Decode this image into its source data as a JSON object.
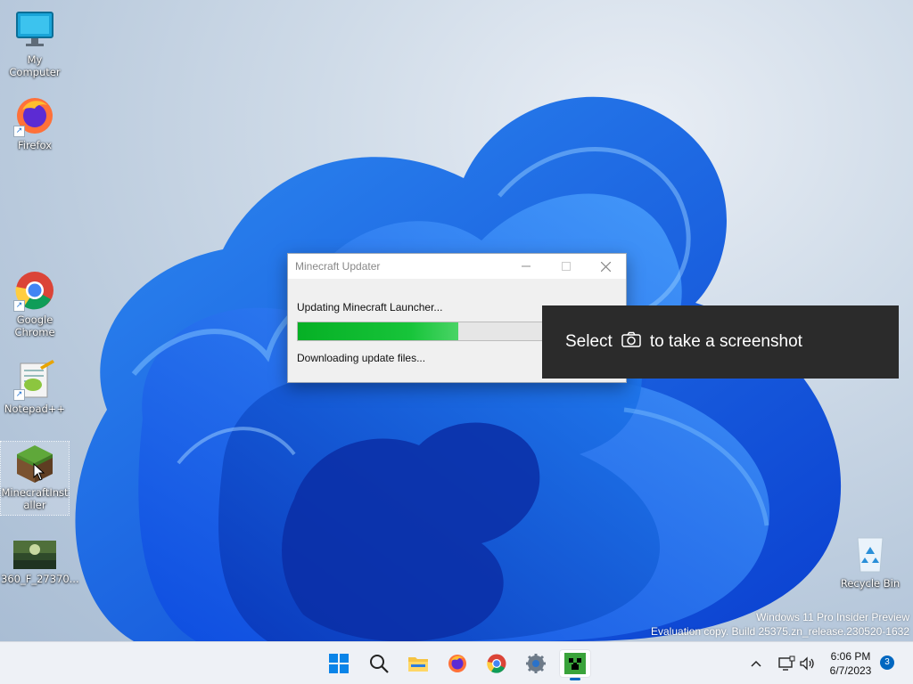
{
  "desktop": {
    "icons": [
      {
        "label": "My Computer",
        "icon": "monitor-icon"
      },
      {
        "label": "Firefox",
        "icon": "firefox-icon"
      },
      {
        "label": "Google Chrome",
        "icon": "chrome-icon"
      },
      {
        "label": "Notepad++",
        "icon": "notepadpp-icon"
      },
      {
        "label": "MinecraftInstaller",
        "icon": "minecraft-icon"
      },
      {
        "label": "360_F_27370...",
        "icon": "image-thumbnail-icon"
      },
      {
        "label": "Recycle Bin",
        "icon": "recycle-bin-icon"
      }
    ]
  },
  "updater": {
    "title": "Minecraft Updater",
    "status_line": "Updating Minecraft Launcher...",
    "progress": 0.5,
    "detail_line": "Downloading update files...",
    "colors": {
      "progress_fill": "#06b025"
    }
  },
  "toast": {
    "before": "Select",
    "icon": "camera-icon",
    "after": "to take a screenshot"
  },
  "watermark": {
    "line1": "Windows 11 Pro Insider Preview",
    "line2": "Evaluation copy. Build 25375.zn_release.230520-1632"
  },
  "taskbar": {
    "apps": [
      "start-icon",
      "search-icon",
      "file-explorer-icon",
      "firefox-icon",
      "chrome-icon",
      "settings-icon",
      "minecraft-icon"
    ],
    "time": "6:06 PM",
    "date": "6/7/2023",
    "notification_count": "3"
  }
}
